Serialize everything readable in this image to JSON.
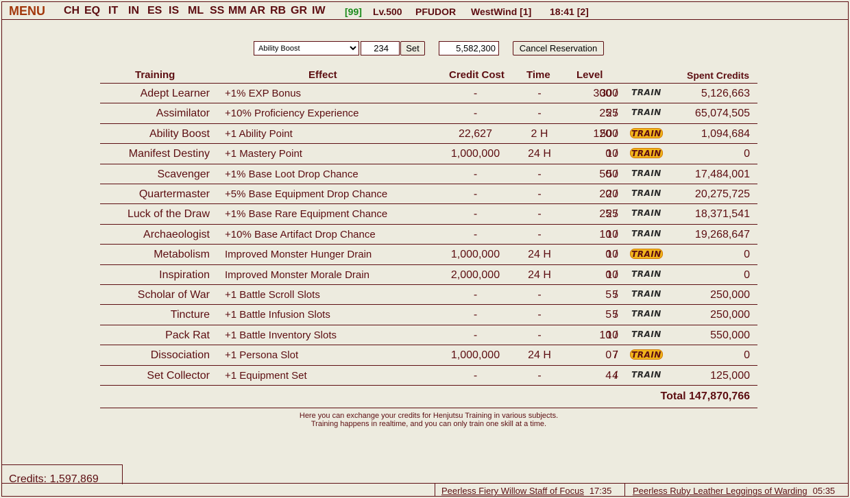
{
  "topbar": {
    "menu": "MENU",
    "nav": [
      "CH",
      "EQ",
      "IT",
      "IN",
      "ES",
      "IS",
      "ML",
      "SS",
      "MM",
      "AR",
      "RB",
      "GR",
      "IW"
    ],
    "count": "[99]",
    "level": "Lv.500",
    "persona": "PFUDOR",
    "world": "WestWind [1]",
    "clock": "18:41 [2]"
  },
  "controls": {
    "selected_training": "Ability Boost",
    "amount": "234",
    "set_label": "Set",
    "credits_value": "5,582,300",
    "cancel_label": "Cancel Reservation"
  },
  "table": {
    "headers": {
      "training": "Training",
      "effect": "Effect",
      "cost": "Credit Cost",
      "time": "Time",
      "level": "Level",
      "spent": "Spent Credits"
    },
    "train_label": "TRAIN",
    "rows": [
      {
        "name": "Adept Learner",
        "effect": "+1% EXP Bonus",
        "cost": "-",
        "time": "-",
        "level": "300 /",
        "max": "300",
        "spent": "5,126,663",
        "trainable": false
      },
      {
        "name": "Assimilator",
        "effect": "+10% Proficiency Experience",
        "cost": "-",
        "time": "-",
        "level": "25 /",
        "max": "25",
        "spent": "65,074,505",
        "trainable": false
      },
      {
        "name": "Ability Boost",
        "effect": "+1 Ability Point",
        "cost": "22,627",
        "time": "2 H",
        "level": "120 /",
        "max": "500",
        "spent": "1,094,684",
        "trainable": true
      },
      {
        "name": "Manifest Destiny",
        "effect": "+1 Mastery Point",
        "cost": "1,000,000",
        "time": "24 H",
        "level": "0 /",
        "max": "10",
        "spent": "0",
        "trainable": true
      },
      {
        "name": "Scavenger",
        "effect": "+1% Base Loot Drop Chance",
        "cost": "-",
        "time": "-",
        "level": "50 /",
        "max": "50",
        "spent": "17,484,001",
        "trainable": false
      },
      {
        "name": "Quartermaster",
        "effect": "+5% Base Equipment Drop Chance",
        "cost": "-",
        "time": "-",
        "level": "20 /",
        "max": "20",
        "spent": "20,275,725",
        "trainable": false
      },
      {
        "name": "Luck of the Draw",
        "effect": "+1% Base Rare Equipment Chance",
        "cost": "-",
        "time": "-",
        "level": "25 /",
        "max": "25",
        "spent": "18,371,541",
        "trainable": false
      },
      {
        "name": "Archaeologist",
        "effect": "+10% Base Artifact Drop Chance",
        "cost": "-",
        "time": "-",
        "level": "10 /",
        "max": "10",
        "spent": "19,268,647",
        "trainable": false
      },
      {
        "name": "Metabolism",
        "effect": "Improved Monster Hunger Drain",
        "cost": "1,000,000",
        "time": "24 H",
        "level": "0 /",
        "max": "10",
        "spent": "0",
        "trainable": true
      },
      {
        "name": "Inspiration",
        "effect": "Improved Monster Morale Drain",
        "cost": "2,000,000",
        "time": "24 H",
        "level": "0 /",
        "max": "10",
        "spent": "0",
        "trainable": false
      },
      {
        "name": "Scholar of War",
        "effect": "+1 Battle Scroll Slots",
        "cost": "-",
        "time": "-",
        "level": "5 /",
        "max": "5",
        "spent": "250,000",
        "trainable": false
      },
      {
        "name": "Tincture",
        "effect": "+1 Battle Infusion Slots",
        "cost": "-",
        "time": "-",
        "level": "5 /",
        "max": "5",
        "spent": "250,000",
        "trainable": false
      },
      {
        "name": "Pack Rat",
        "effect": "+1 Battle Inventory Slots",
        "cost": "-",
        "time": "-",
        "level": "10 /",
        "max": "10",
        "spent": "550,000",
        "trainable": false
      },
      {
        "name": "Dissociation",
        "effect": "+1 Persona Slot",
        "cost": "1,000,000",
        "time": "24 H",
        "level": "0 /",
        "max": "7",
        "spent": "0",
        "trainable": true
      },
      {
        "name": "Set Collector",
        "effect": "+1 Equipment Set",
        "cost": "-",
        "time": "-",
        "level": "4 /",
        "max": "4",
        "spent": "125,000",
        "trainable": false
      }
    ],
    "total": "Total 147,870,766"
  },
  "notes": {
    "line1": "Here you can exchange your credits for Henjutsu Training in various subjects.",
    "line2": "Training happens in realtime, and you can only train one skill at a time."
  },
  "credits": "Credits: 1,597,869",
  "bottom": {
    "item1": "Peerless Fiery Willow Staff of Focus",
    "time1": "17:35",
    "item2": "Peerless Ruby Leather Leggings of Warding",
    "time2": "05:35"
  }
}
